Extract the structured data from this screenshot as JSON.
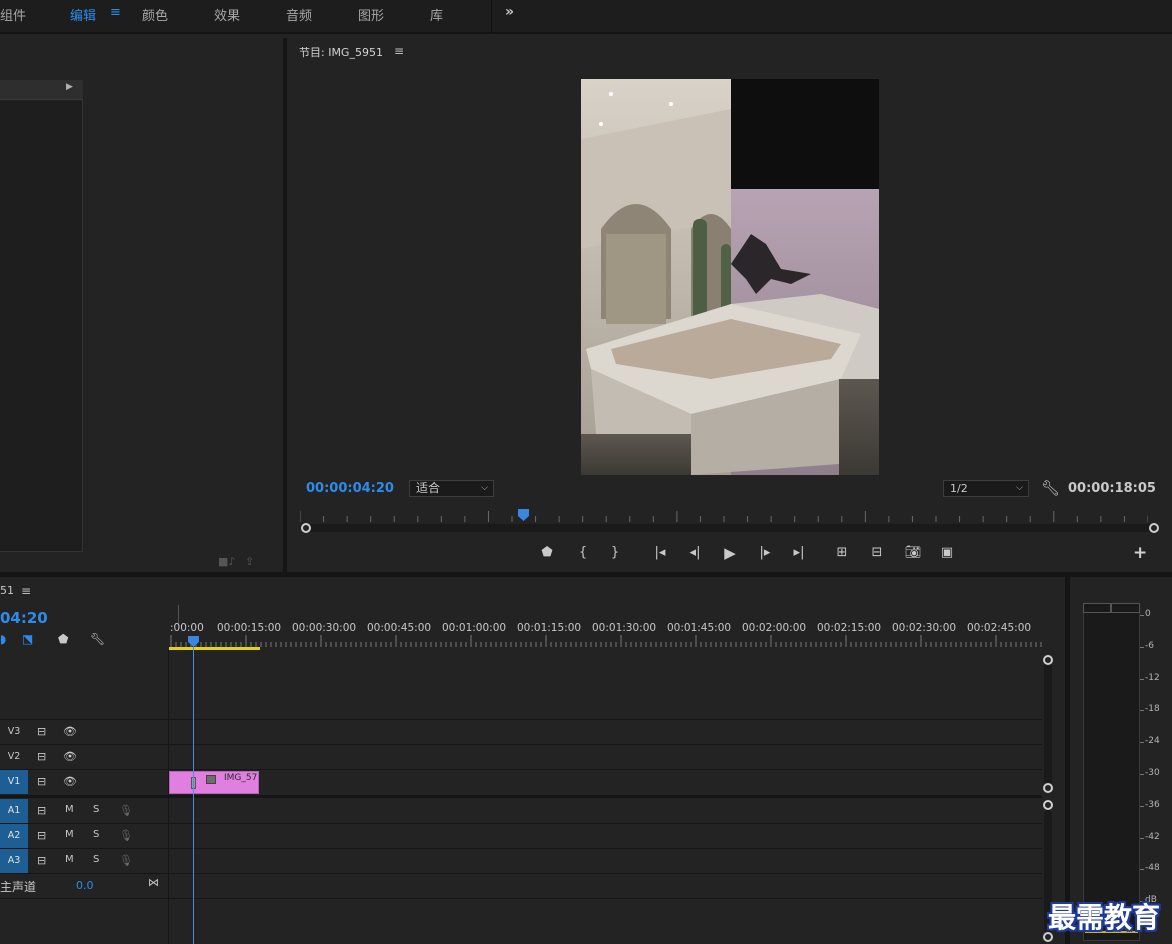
{
  "workspace_tabs": [
    {
      "label": "组件",
      "active": false
    },
    {
      "label": "编辑",
      "active": true
    },
    {
      "label": "颜色",
      "active": false
    },
    {
      "label": "效果",
      "active": false
    },
    {
      "label": "音频",
      "active": false
    },
    {
      "label": "图形",
      "active": false
    },
    {
      "label": "库",
      "active": false
    }
  ],
  "workspace_menu_glyph": "≡",
  "workspace_more_glyph": "»",
  "program_monitor": {
    "title": "节目: IMG_5951",
    "menu_glyph": "≡",
    "current_timecode": "00:00:04:20",
    "zoom_select": "适合",
    "resolution_select": "1/2",
    "duration_timecode": "00:00:18:05",
    "playhead_fraction": 0.26,
    "transport_icons": [
      "marker-icon",
      "mark-in-icon",
      "mark-out-icon",
      "go-to-in-icon",
      "step-back-icon",
      "play-icon",
      "step-forward-icon",
      "go-to-out-icon",
      "insert-icon",
      "overwrite-icon",
      "export-frame-icon",
      "compare-view-icon"
    ]
  },
  "timeline": {
    "sequence_name_fragment": "51",
    "menu_glyph": "≡",
    "timecode": "04:20",
    "ruler_labels": [
      ":00:00",
      "00:00:15:00",
      "00:00:30:00",
      "00:00:45:00",
      "00:01:00:00",
      "00:01:15:00",
      "00:01:30:00",
      "00:01:45:00",
      "00:02:00:00",
      "00:02:15:00",
      "00:02:30:00",
      "00:02:45:00"
    ],
    "video_tracks": [
      {
        "name": "V3",
        "targeted": false
      },
      {
        "name": "V2",
        "targeted": false
      },
      {
        "name": "V1",
        "targeted": true
      }
    ],
    "audio_tracks": [
      {
        "name": "A1",
        "mute": "M",
        "solo": "S"
      },
      {
        "name": "A2",
        "mute": "M",
        "solo": "S"
      },
      {
        "name": "A3",
        "mute": "M",
        "solo": "S"
      }
    ],
    "master": {
      "label": "主声道",
      "value": "0.0"
    },
    "clip": {
      "label": "IMG_57",
      "color": "#e07fe0"
    }
  },
  "audio_meter": {
    "db_labels": [
      "0",
      "-6",
      "-12",
      "-18",
      "-24",
      "-30",
      "-36",
      "-42",
      "-48",
      "dB"
    ]
  },
  "watermark": "最需教育",
  "colors": {
    "accent": "#2d8ceb",
    "clip": "#e07fe0",
    "work_area": "#e4d21a"
  }
}
